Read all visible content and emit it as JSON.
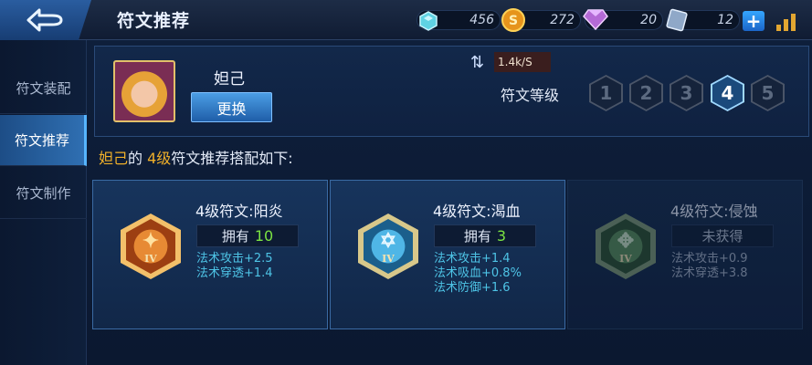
{
  "header": {
    "title": "符文推荐",
    "resources": [
      {
        "name": "crystal",
        "value": "456"
      },
      {
        "name": "gold",
        "value": "272"
      },
      {
        "name": "diamond",
        "value": "20"
      },
      {
        "name": "voucher",
        "value": "12"
      }
    ],
    "plus_label": "+"
  },
  "sidebar": {
    "items": [
      {
        "label": "符文装配"
      },
      {
        "label": "符文推荐"
      },
      {
        "label": "符文制作"
      }
    ],
    "active_index": 1
  },
  "hero": {
    "name": "妲己",
    "change_label": "更换",
    "rate": "1.4k/S",
    "level_label": "符文等级",
    "levels": [
      "1",
      "2",
      "3",
      "4",
      "5"
    ],
    "active_level": "4"
  },
  "recommend": {
    "hero": "妲己",
    "prefix": "的 ",
    "level": "4级",
    "suffix": "符文推荐搭配如下:"
  },
  "cards": [
    {
      "name": "4级符文:阳炎",
      "owned_label": "拥有",
      "owned_count": "10",
      "stats": [
        "法术攻击+2.5",
        "法术穿透+1.4"
      ],
      "color": "#d9742a",
      "numeral": "IV"
    },
    {
      "name": "4级符文:渴血",
      "owned_label": "拥有",
      "owned_count": "3",
      "stats": [
        "法术攻击+1.4",
        "法术吸血+0.8%",
        "法术防御+1.6"
      ],
      "color": "#2f9fd8",
      "numeral": "IV"
    },
    {
      "name": "4级符文:侵蚀",
      "owned_label": "未获得",
      "owned_count": "",
      "stats": [
        "法术攻击+0.9",
        "法术穿透+3.8"
      ],
      "color": "#4f9a53",
      "numeral": "IV"
    }
  ]
}
